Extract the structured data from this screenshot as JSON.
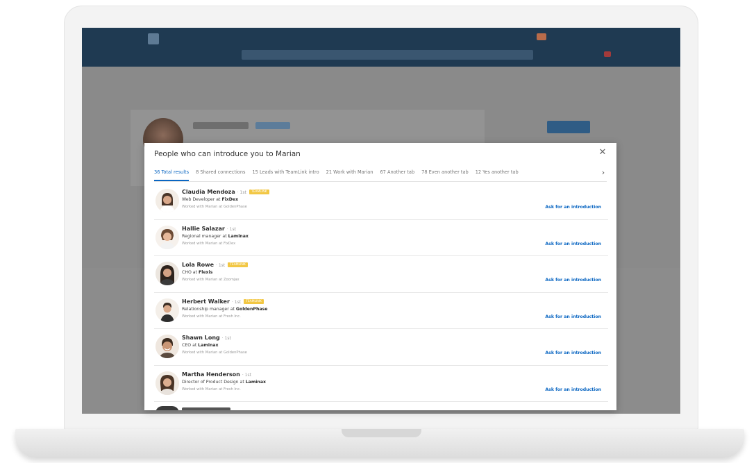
{
  "modal": {
    "title": "People who can introduce you to Marian",
    "close_icon": "close-icon",
    "tabs": [
      {
        "label": "36 Total results",
        "active": true
      },
      {
        "label": "8 Shared connections",
        "active": false
      },
      {
        "label": "15 Leads with TeamLink intro",
        "active": false
      },
      {
        "label": "21 Work with Marian",
        "active": false
      },
      {
        "label": "67 Another tab",
        "active": false
      },
      {
        "label": "78 Even another tab",
        "active": false
      },
      {
        "label": "12 Yes another tab",
        "active": false
      }
    ],
    "tabs_arrow_icon": "chevron-right-icon"
  },
  "people": [
    {
      "name": "Claudia Mendoza",
      "degree": "· 1st",
      "badge": "TEAMLINK",
      "title_prefix": "Web Developer at",
      "company": "FixDex",
      "worked": "Worked with Marian at GoldenPhase",
      "action": "Ask for an introduction"
    },
    {
      "name": "Hallie Salazar",
      "degree": "· 1st",
      "badge": "",
      "title_prefix": "Regional manager at",
      "company": "Laminax",
      "worked": "Worked with Marian at FixDex",
      "action": "Ask for an introduction"
    },
    {
      "name": "Lola Rowe",
      "degree": "· 1st",
      "badge": "TEAMLINK",
      "title_prefix": "CHO at",
      "company": "Flexis",
      "worked": "Worked with Marian at Zoomjax",
      "action": "Ask for an introduction"
    },
    {
      "name": "Herbert Walker",
      "degree": "· 1st",
      "badge": "TEAMLINK",
      "title_prefix": "Relationship manager at",
      "company": "GoldenPhase",
      "worked": "Worked with Marian at Fresh Inc.",
      "action": "Ask for an introduction"
    },
    {
      "name": "Shawn Long",
      "degree": "· 1st",
      "badge": "",
      "title_prefix": "CEO at",
      "company": "Laminax",
      "worked": "Worked with Marian at GoldenPhase",
      "action": "Ask for an introduction"
    },
    {
      "name": "Martha Henderson",
      "degree": "· 1st",
      "badge": "",
      "title_prefix": "Director of Product Design at",
      "company": "Laminax",
      "worked": "Worked with Marian at Fresh Inc.",
      "action": "Ask for an introduction"
    }
  ],
  "colors": {
    "link": "#0a66c2",
    "badge": "#f2c744",
    "nav": "#1f3a52"
  }
}
